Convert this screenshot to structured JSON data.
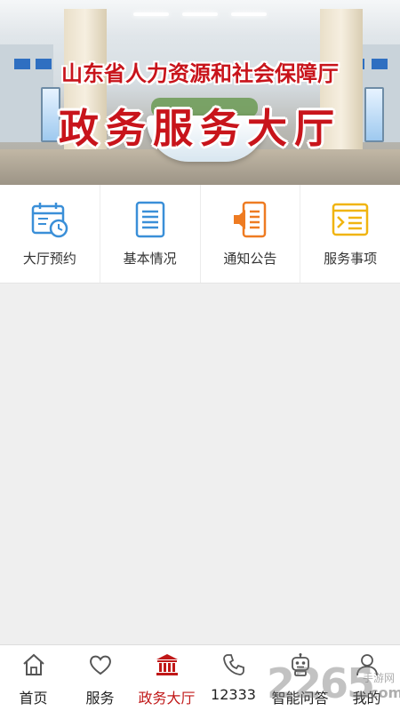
{
  "banner": {
    "title_line1": "山东省人力资源和社会保障厅",
    "title_line2": "政务服务大厅"
  },
  "quick_menu": [
    {
      "label": "大厅预约",
      "icon": "calendar-clock-icon",
      "color": "#3a8fd8"
    },
    {
      "label": "基本情况",
      "icon": "document-list-icon",
      "color": "#3a8fd8"
    },
    {
      "label": "通知公告",
      "icon": "megaphone-icon",
      "color": "#ee7b22"
    },
    {
      "label": "服务事项",
      "icon": "service-list-icon",
      "color": "#f0b40f"
    }
  ],
  "bottom_nav": [
    {
      "label": "首页",
      "icon": "home-icon",
      "active": false
    },
    {
      "label": "服务",
      "icon": "heart-icon",
      "active": false
    },
    {
      "label": "政务大厅",
      "icon": "government-building-icon",
      "active": true
    },
    {
      "label": "12333",
      "icon": "phone-icon",
      "active": false
    },
    {
      "label": "智能问答",
      "icon": "robot-icon",
      "active": false
    },
    {
      "label": "我的",
      "icon": "user-icon",
      "active": false
    }
  ],
  "watermark": {
    "number": "2265",
    "sub": "手游网",
    "suffix": ".com"
  },
  "colors": {
    "accent": "#c01818",
    "title_red": "#c8141b",
    "background": "#efefef"
  }
}
